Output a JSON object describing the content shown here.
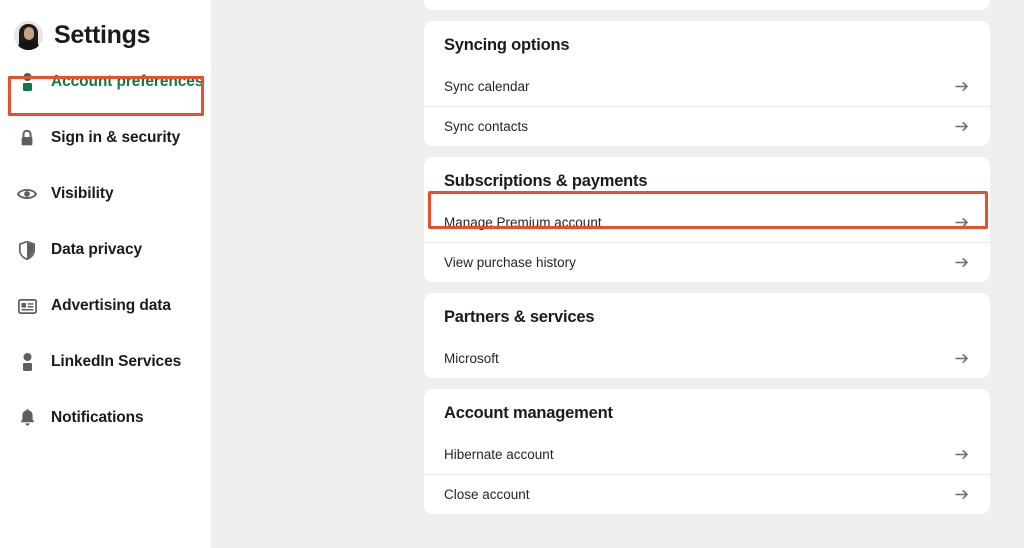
{
  "sidebar": {
    "title": "Settings",
    "avatar_name": "user-avatar",
    "items": [
      {
        "label": "Account preferences",
        "icon": "person-icon",
        "active": true
      },
      {
        "label": "Sign in & security",
        "icon": "lock-icon",
        "active": false
      },
      {
        "label": "Visibility",
        "icon": "eye-icon",
        "active": false
      },
      {
        "label": "Data privacy",
        "icon": "shield-icon",
        "active": false
      },
      {
        "label": "Advertising data",
        "icon": "id-card-icon",
        "active": false
      },
      {
        "label": "LinkedIn Services",
        "icon": "person-icon",
        "active": false
      },
      {
        "label": "Notifications",
        "icon": "bell-icon",
        "active": false
      }
    ]
  },
  "main": {
    "cards": [
      {
        "title": "Syncing options",
        "rows": [
          {
            "label": "Sync calendar",
            "icon": "arrow-right-icon"
          },
          {
            "label": "Sync contacts",
            "icon": "arrow-right-icon"
          }
        ]
      },
      {
        "title": "Subscriptions & payments",
        "rows": [
          {
            "label": "Manage Premium account",
            "icon": "arrow-right-icon"
          },
          {
            "label": "View purchase history",
            "icon": "arrow-right-icon"
          }
        ]
      },
      {
        "title": "Partners & services",
        "rows": [
          {
            "label": "Microsoft",
            "icon": "arrow-right-icon"
          }
        ]
      },
      {
        "title": "Account management",
        "rows": [
          {
            "label": "Hibernate account",
            "icon": "arrow-right-icon"
          },
          {
            "label": "Close account",
            "icon": "arrow-right-icon"
          }
        ]
      }
    ]
  },
  "colors": {
    "accent_green": "#0b7a4b",
    "highlight_red": "#e8502b",
    "page_background": "#f0efed",
    "card_background": "#ffffff",
    "text_primary": "#1b1b1b",
    "icon_gray": "#5f5f5f"
  }
}
